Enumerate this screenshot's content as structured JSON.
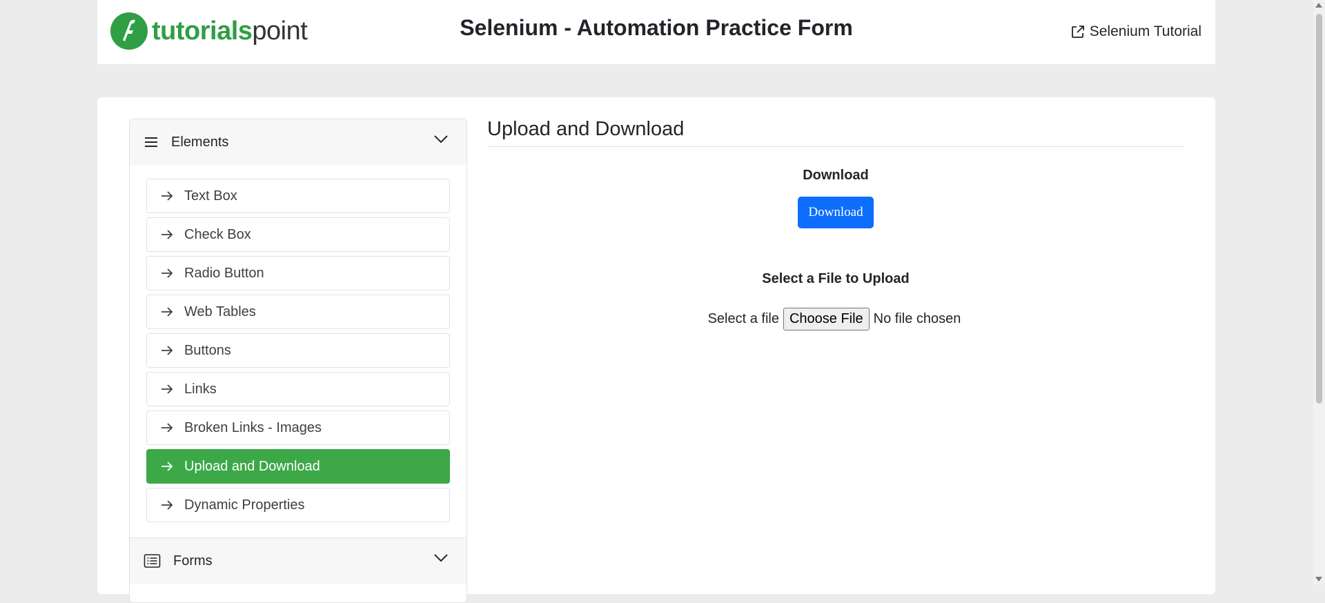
{
  "header": {
    "logo_part1": "tutorials",
    "logo_part2": "point",
    "title": "Selenium - Automation Practice Form",
    "tutorial_link": "Selenium Tutorial"
  },
  "sidebar": {
    "elements_header": "Elements",
    "items": [
      {
        "label": "Text Box"
      },
      {
        "label": "Check Box"
      },
      {
        "label": "Radio Button"
      },
      {
        "label": "Web Tables"
      },
      {
        "label": "Buttons"
      },
      {
        "label": "Links"
      },
      {
        "label": "Broken Links - Images"
      },
      {
        "label": "Upload and Download"
      },
      {
        "label": "Dynamic Properties"
      }
    ],
    "active_item": "Upload and Download",
    "forms_header": "Forms"
  },
  "main": {
    "heading": "Upload and Download",
    "download_label": "Download",
    "download_button": "Download",
    "upload_label": "Select a File to Upload",
    "file_label": "Select a file",
    "choose_button": "Choose File",
    "file_status": "No file chosen"
  },
  "colors": {
    "active_green": "#3ca847",
    "brand_green": "#2f9e44",
    "primary_blue": "#0d6efd"
  }
}
